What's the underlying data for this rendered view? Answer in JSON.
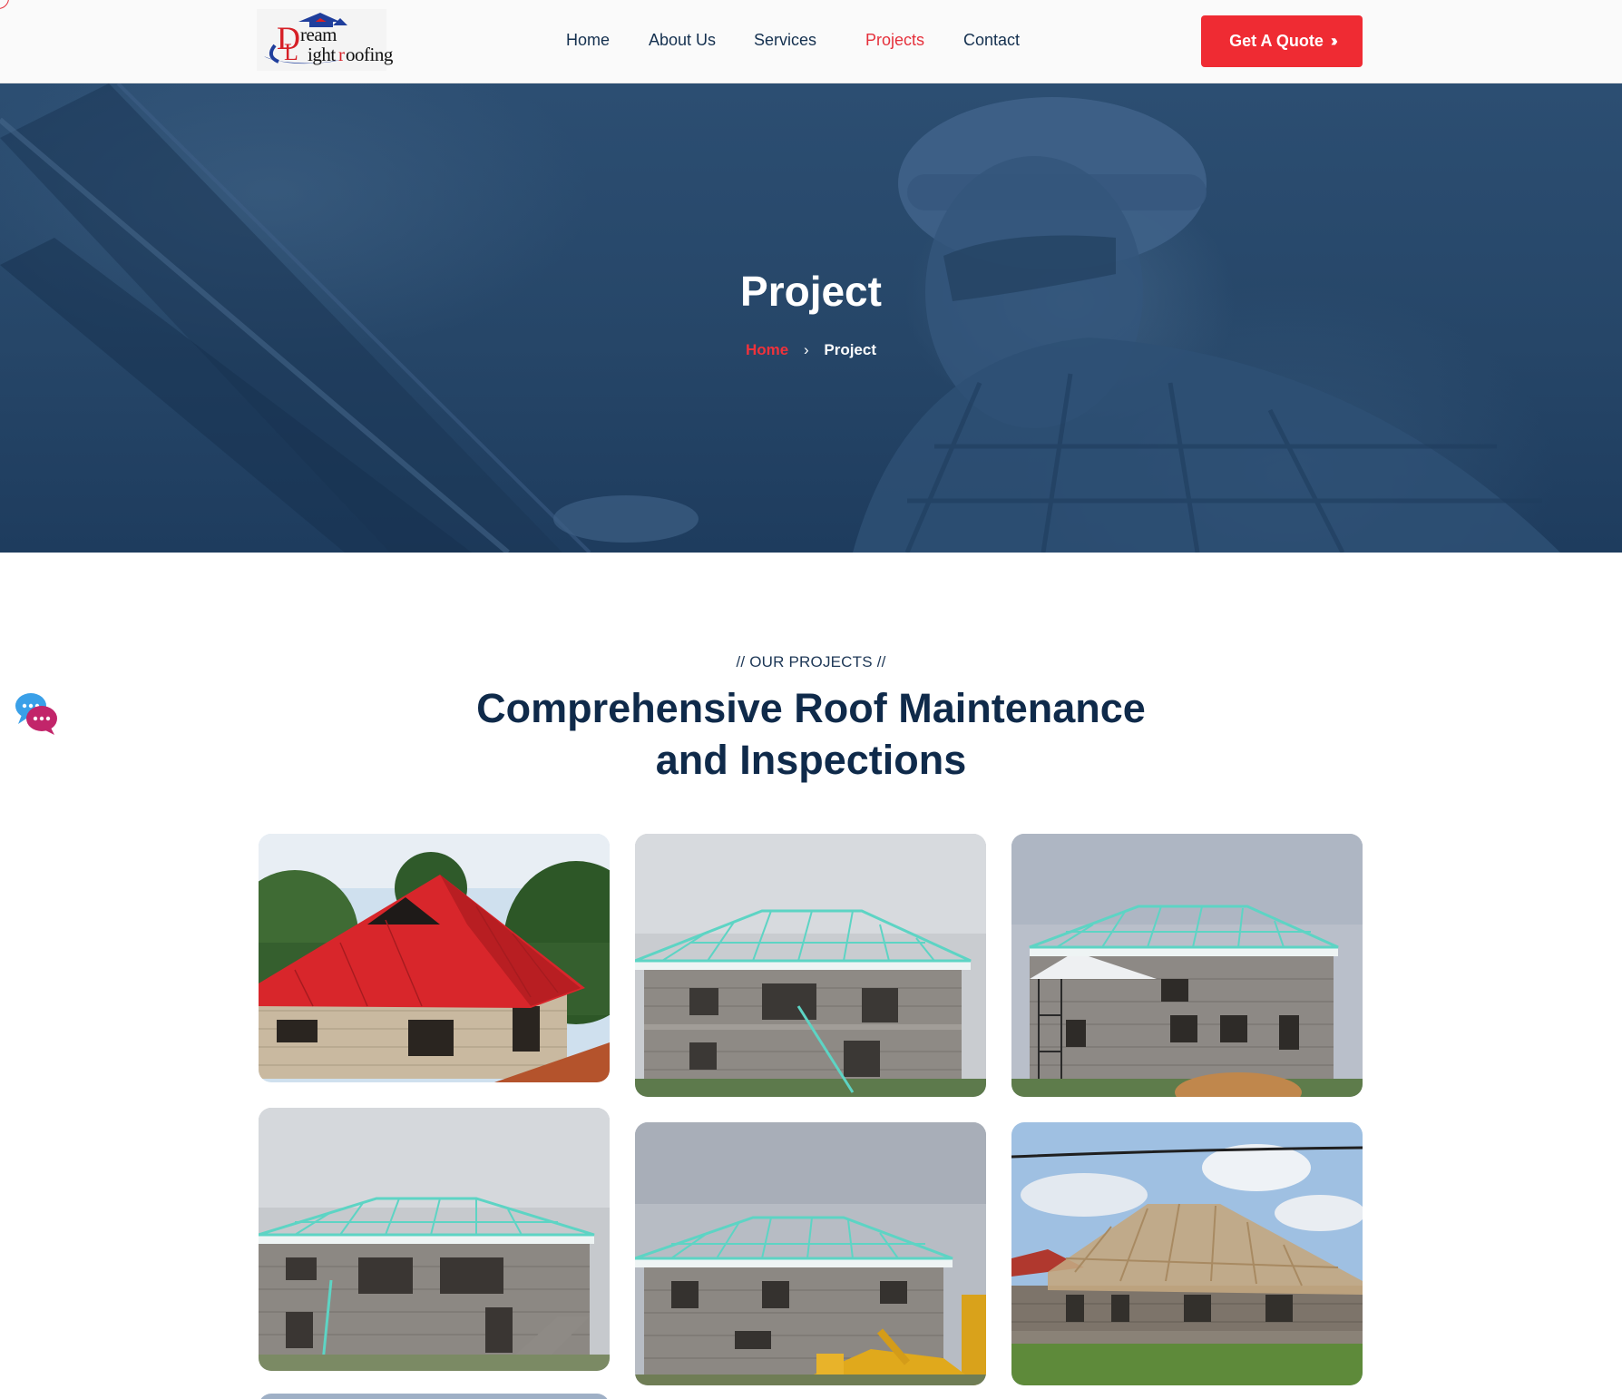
{
  "header": {
    "logo_text": {
      "part1": "D",
      "part2": "ream",
      "part3": "L",
      "part4": "ight",
      "part5": "r",
      "part6": "oofing"
    },
    "nav": [
      "Home",
      "About Us",
      "Services",
      "Projects",
      "Contact"
    ],
    "active_nav": "Projects",
    "quote_button": "Get A Quote",
    "quote_icon": "double-chevron-right-icon"
  },
  "hero": {
    "title": "Project",
    "breadcrumb": {
      "home": "Home",
      "separator": ">",
      "current": "Project"
    }
  },
  "section": {
    "eyebrow": "// OUR PROJECTS //",
    "title_line1": "Comprehensive Roof Maintenance",
    "title_line2": "and Inspections"
  },
  "projects": [
    {
      "name": "red-roof-house"
    },
    {
      "name": "teal-truss-building-1"
    },
    {
      "name": "teal-truss-building-2"
    },
    {
      "name": "teal-truss-building-3"
    },
    {
      "name": "teal-truss-building-excavator"
    },
    {
      "name": "wooden-truss-house"
    }
  ],
  "colors": {
    "accent": "#ef2b33",
    "navy": "#0f2a4a",
    "hero_overlay": "#264668",
    "truss": "#4fd1c5"
  }
}
